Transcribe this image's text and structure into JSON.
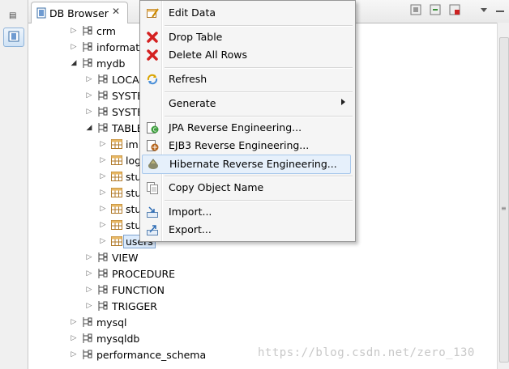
{
  "view": {
    "tab_label": "DB Browser",
    "colors": {
      "selection": "#dcebfc",
      "menu_highlight": "#e6f0fb",
      "accent": "#3a6ea5"
    }
  },
  "tree": {
    "nodes": [
      {
        "label": "crm"
      },
      {
        "label": "informati"
      },
      {
        "label": "mydb"
      },
      {
        "label": "LOCAL"
      },
      {
        "label": "SYSTE"
      },
      {
        "label": "SYSTE"
      },
      {
        "label": "TABLE"
      },
      {
        "label": "im"
      },
      {
        "label": "log"
      },
      {
        "label": "stu"
      },
      {
        "label": "stu"
      },
      {
        "label": "stu"
      },
      {
        "label": "stu"
      },
      {
        "label": "users"
      },
      {
        "label": "VIEW"
      },
      {
        "label": "PROCEDURE"
      },
      {
        "label": "FUNCTION"
      },
      {
        "label": "TRIGGER"
      },
      {
        "label": "mysql"
      },
      {
        "label": "mysqldb"
      },
      {
        "label": "performance_schema"
      }
    ]
  },
  "context_menu": {
    "items": [
      {
        "label": "Edit Data",
        "icon": "edit-data-icon"
      },
      {
        "label": "Drop Table",
        "icon": "red-x-icon"
      },
      {
        "label": "Delete All Rows",
        "icon": "red-x-icon"
      },
      {
        "label": "Refresh",
        "icon": "refresh-icon"
      },
      {
        "label": "Generate",
        "icon": "",
        "submenu": true
      },
      {
        "label": "JPA Reverse Engineering...",
        "icon": "jpa-icon"
      },
      {
        "label": "EJB3 Reverse Engineering...",
        "icon": "ejb3-icon"
      },
      {
        "label": "Hibernate Reverse Engineering...",
        "icon": "hibernate-icon"
      },
      {
        "label": "Copy Object Name",
        "icon": "copy-icon"
      },
      {
        "label": "Import...",
        "icon": "import-icon"
      },
      {
        "label": "Export...",
        "icon": "export-icon"
      }
    ]
  },
  "watermark": "https://blog.csdn.net/zero_130"
}
